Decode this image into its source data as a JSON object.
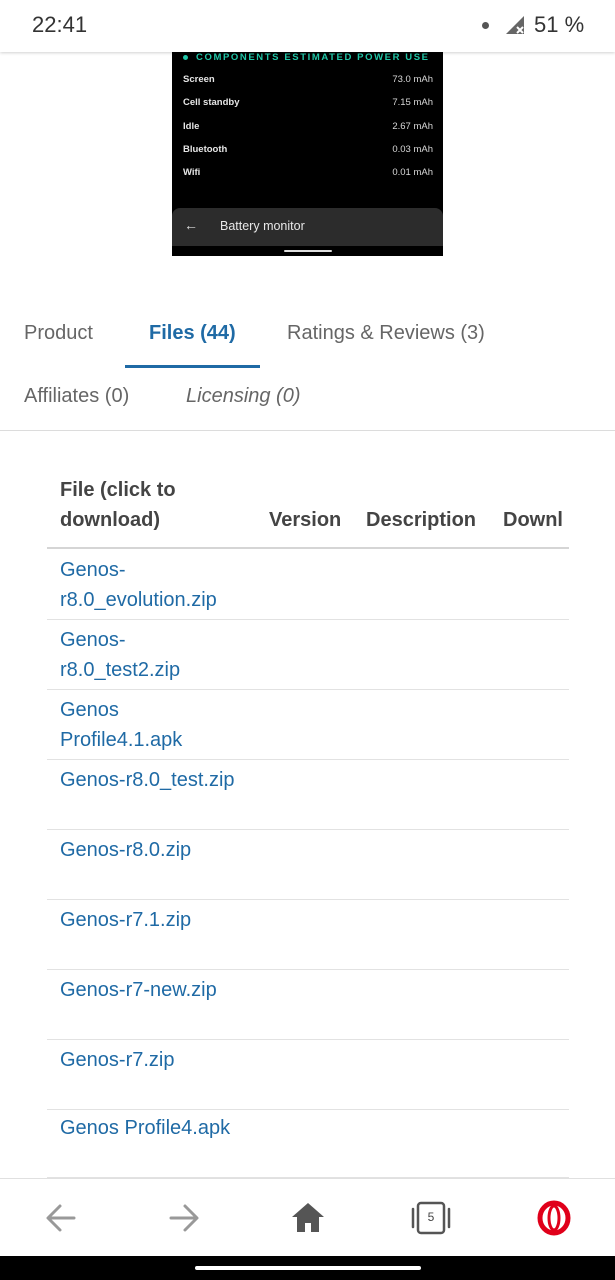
{
  "status_bar": {
    "time": "22:41",
    "battery": "51 %"
  },
  "screenshot": {
    "header": "COMPONENTS ESTIMATED POWER USE",
    "rows": [
      {
        "name": "Screen",
        "value": "73.0 mAh"
      },
      {
        "name": "Cell standby",
        "value": "7.15 mAh"
      },
      {
        "name": "Idle",
        "value": "2.67 mAh"
      },
      {
        "name": "Bluetooth",
        "value": "0.03 mAh"
      },
      {
        "name": "Wifi",
        "value": "0.01 mAh"
      }
    ],
    "bottom_bar_title": "Battery monitor"
  },
  "tabs": {
    "product": "Product",
    "files": "Files (44)",
    "ratings": "Ratings & Reviews (3)",
    "affiliates": "Affiliates (0)",
    "licensing": "Licensing (0)",
    "active": "files"
  },
  "files_table": {
    "headers": {
      "file_line1": "File (click to",
      "file_line2": "download)",
      "version": "Version",
      "description": "Description",
      "downloads": "Downl"
    },
    "rows": [
      {
        "line1": "Genos-",
        "line2": "r8.0_evolution.zip"
      },
      {
        "line1": "Genos-",
        "line2": "r8.0_test2.zip"
      },
      {
        "line1": "Genos",
        "line2": "Profile4.1.apk"
      },
      {
        "line1": "Genos-r8.0_test.zip",
        "line2": ""
      },
      {
        "line1": "Genos-r8.0.zip",
        "line2": ""
      },
      {
        "line1": "Genos-r7.1.zip",
        "line2": ""
      },
      {
        "line1": "Genos-r7-new.zip",
        "line2": ""
      },
      {
        "line1": "Genos-r7.zip",
        "line2": ""
      },
      {
        "line1": "Genos Profile4.apk",
        "line2": ""
      }
    ]
  },
  "nav": {
    "tab_count": "5",
    "accent_color": "#e0001a",
    "link_color": "#1f6aa5"
  }
}
